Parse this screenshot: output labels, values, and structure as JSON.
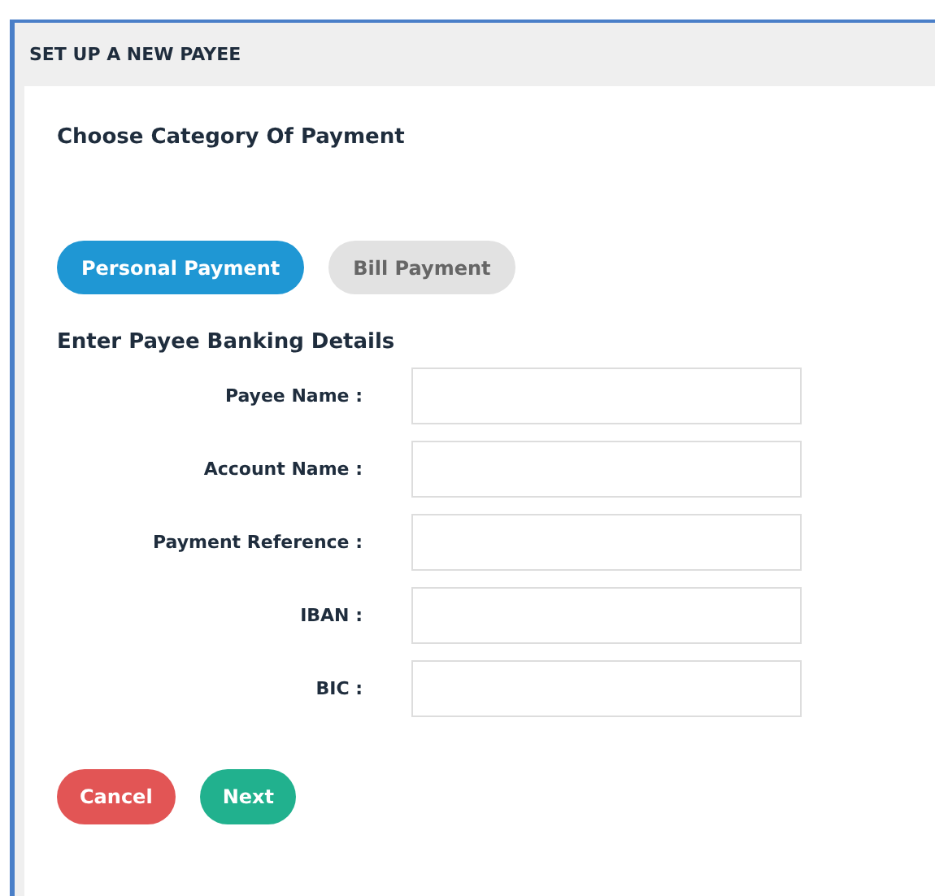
{
  "panel": {
    "title": "SET UP A NEW PAYEE"
  },
  "category_heading": "Choose Category Of Payment",
  "categories": [
    {
      "label": "Personal Payment",
      "selected": true
    },
    {
      "label": "Bill Payment",
      "selected": false
    }
  ],
  "details_heading": "Enter Payee Banking Details",
  "fields": [
    {
      "label": "Payee Name :"
    },
    {
      "label": "Account Name :"
    },
    {
      "label": "Payment Reference :"
    },
    {
      "label": "IBAN :"
    },
    {
      "label": "BIC :"
    }
  ],
  "actions": [
    {
      "label": "Cancel",
      "kind": "cancel"
    },
    {
      "label": "Next",
      "kind": "next"
    }
  ]
}
